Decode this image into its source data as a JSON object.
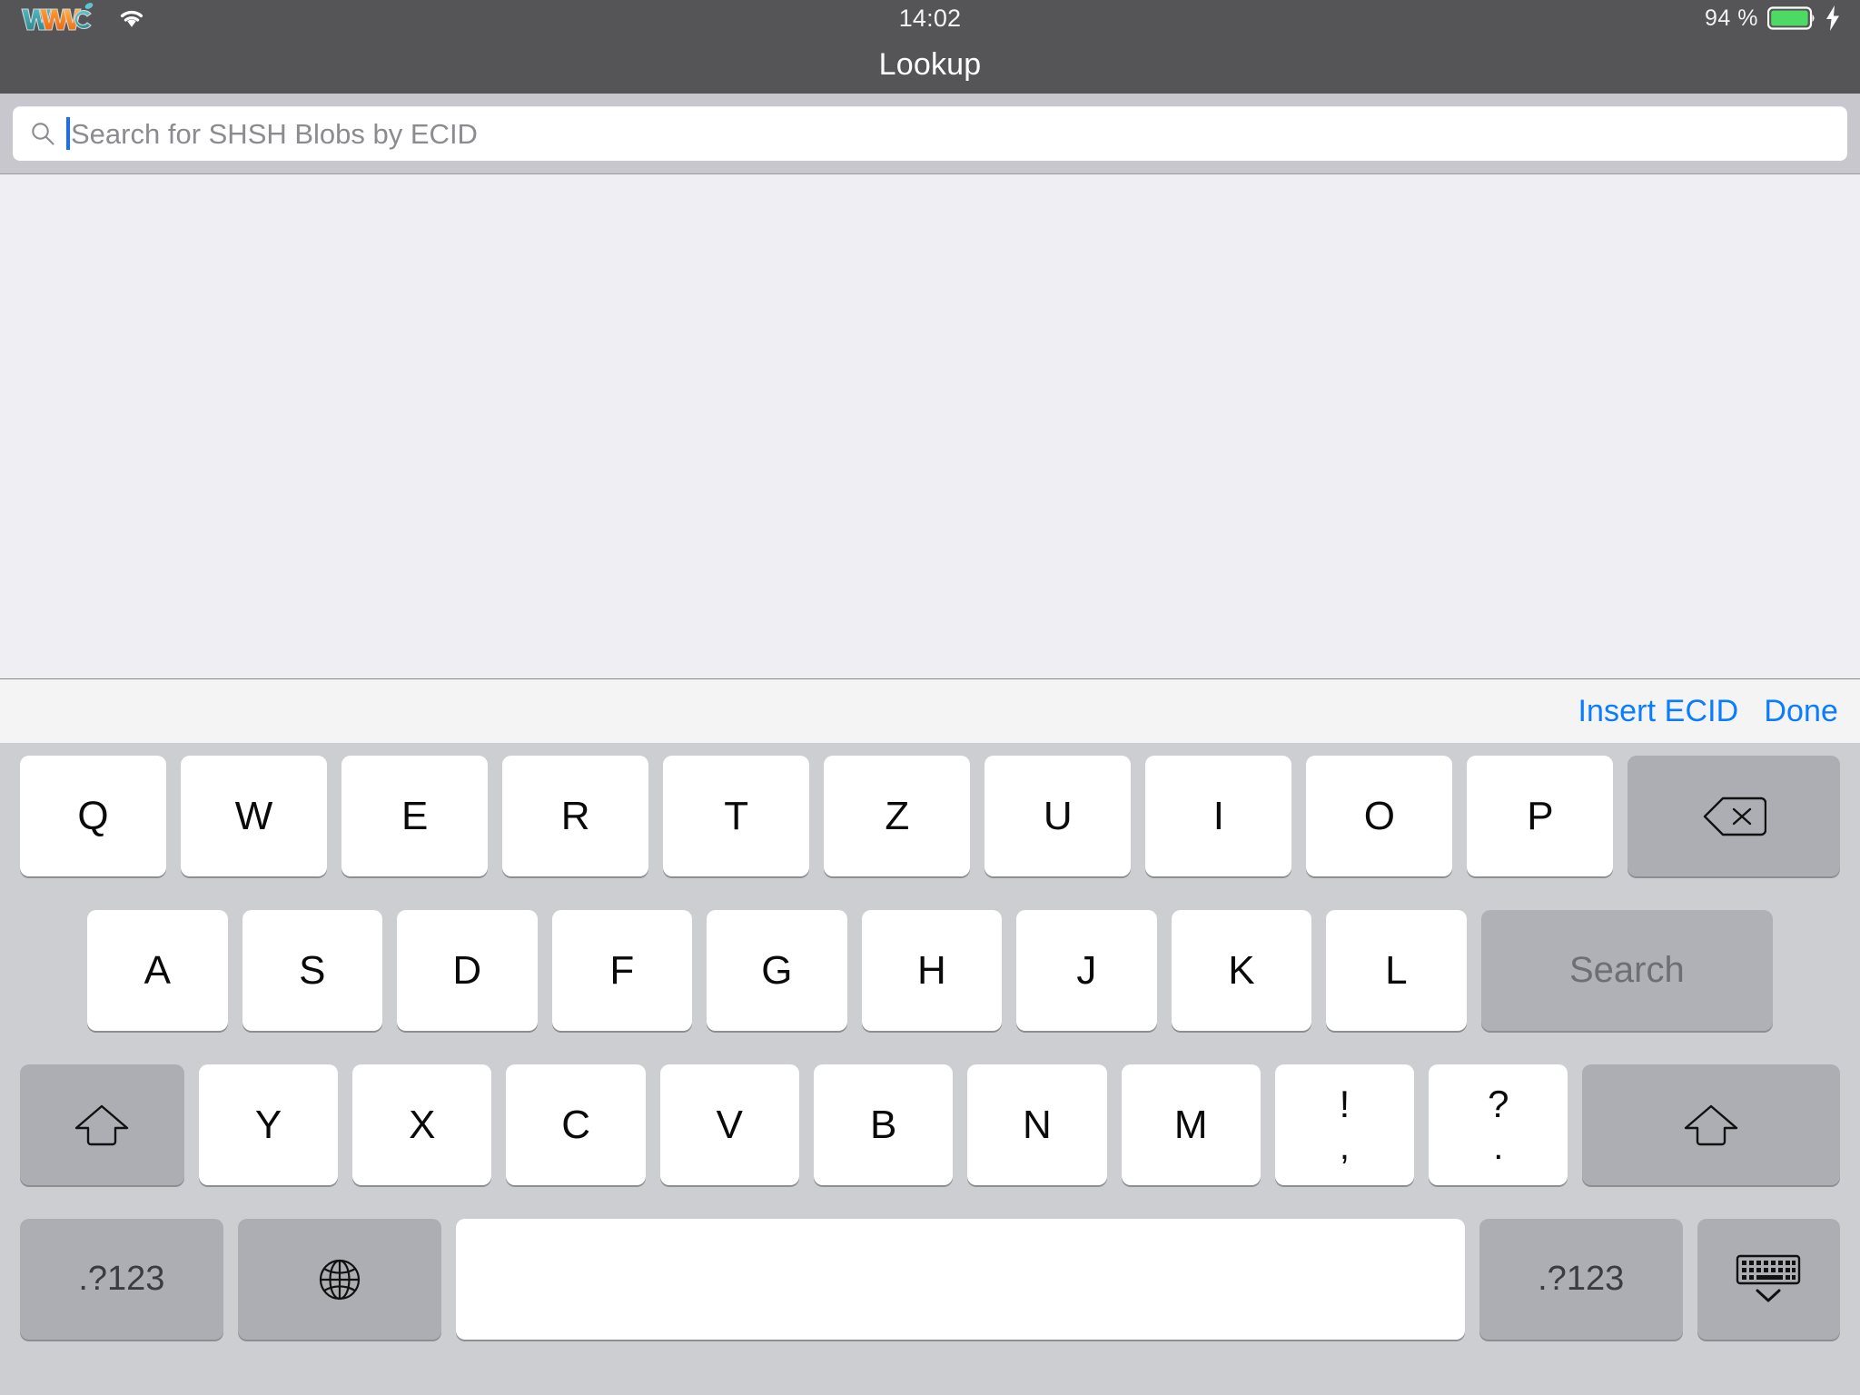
{
  "status_bar": {
    "logo_name": "wwdc-logo",
    "wifi_icon": "wifi-icon",
    "time": "14:02",
    "battery_percent": "94 %",
    "battery_icon": "battery-icon",
    "charging_icon": "lightning-bolt-icon",
    "background_color": "#555557"
  },
  "nav_bar": {
    "title": "Lookup"
  },
  "search": {
    "icon": "search-icon",
    "placeholder": "Search for SHSH Blobs by ECID",
    "value": "",
    "caret_color": "#1a6bff"
  },
  "content": {
    "background_color": "#efeef2",
    "items": []
  },
  "keyboard_toolbar": {
    "insert_ecid_label": "Insert ECID",
    "done_label": "Done",
    "accent_color": "#0a7cff"
  },
  "keyboard": {
    "layout": "QWERTZ",
    "background_color": "#cdced2",
    "row1": [
      {
        "label": "Q",
        "type": "letter"
      },
      {
        "label": "W",
        "type": "letter"
      },
      {
        "label": "E",
        "type": "letter"
      },
      {
        "label": "R",
        "type": "letter"
      },
      {
        "label": "T",
        "type": "letter"
      },
      {
        "label": "Z",
        "type": "letter"
      },
      {
        "label": "U",
        "type": "letter"
      },
      {
        "label": "I",
        "type": "letter"
      },
      {
        "label": "O",
        "type": "letter"
      },
      {
        "label": "P",
        "type": "letter"
      }
    ],
    "backspace_icon": "backspace-delete-icon",
    "row2": [
      {
        "label": "A",
        "type": "letter"
      },
      {
        "label": "S",
        "type": "letter"
      },
      {
        "label": "D",
        "type": "letter"
      },
      {
        "label": "F",
        "type": "letter"
      },
      {
        "label": "G",
        "type": "letter"
      },
      {
        "label": "H",
        "type": "letter"
      },
      {
        "label": "J",
        "type": "letter"
      },
      {
        "label": "K",
        "type": "letter"
      },
      {
        "label": "L",
        "type": "letter"
      }
    ],
    "search_key_label": "Search",
    "row3": [
      {
        "label": "Y",
        "type": "letter"
      },
      {
        "label": "X",
        "type": "letter"
      },
      {
        "label": "C",
        "type": "letter"
      },
      {
        "label": "V",
        "type": "letter"
      },
      {
        "label": "B",
        "type": "letter"
      },
      {
        "label": "N",
        "type": "letter"
      },
      {
        "label": "M",
        "type": "letter"
      }
    ],
    "punct_exclaim": {
      "top": "!",
      "bottom": ","
    },
    "punct_question": {
      "top": "?",
      "bottom": "."
    },
    "shift_left_icon": "shift-arrow-up-icon",
    "shift_right_icon": "shift-arrow-up-icon",
    "numeric_left_label": ".?123",
    "numeric_right_label": ".?123",
    "globe_icon": "globe-language-icon",
    "space_label": "",
    "dismiss_icon": "hide-keyboard-icon"
  }
}
